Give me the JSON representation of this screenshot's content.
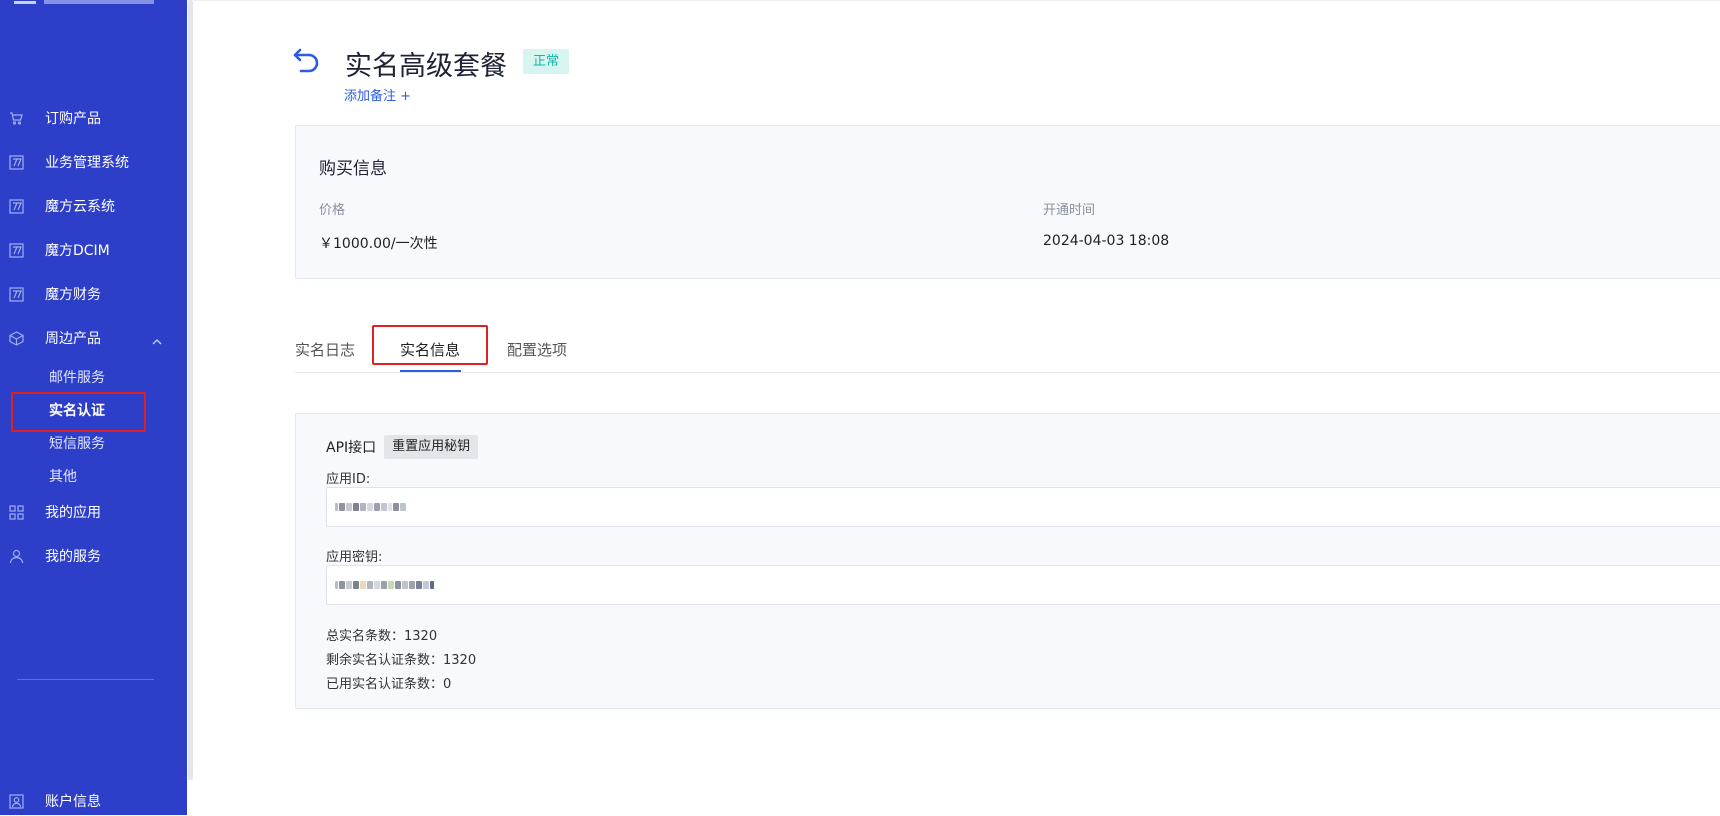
{
  "sidebar": {
    "items": [
      {
        "label": "订购产品",
        "icon": "cart-icon"
      },
      {
        "label": "业务管理系统",
        "icon": "app-icon"
      },
      {
        "label": "魔方云系统",
        "icon": "app-icon"
      },
      {
        "label": "魔方DCIM",
        "icon": "app-icon"
      },
      {
        "label": "魔方财务",
        "icon": "app-icon"
      },
      {
        "label": "周边产品",
        "icon": "box-icon"
      }
    ],
    "sub_items": [
      "邮件服务",
      "实名认证",
      "短信服务",
      "其他"
    ],
    "bottom_items": [
      {
        "label": "我的应用",
        "icon": "grid-icon"
      },
      {
        "label": "我的服务",
        "icon": "user-icon"
      }
    ],
    "account": {
      "label": "账户信息",
      "icon": "account-icon"
    }
  },
  "header": {
    "title": "实名高级套餐",
    "status": "正常",
    "add_note": "添加备注 +"
  },
  "purchase": {
    "title": "购买信息",
    "price_label": "价格",
    "price_value": "￥1000.00/一次性",
    "time_label": "开通时间",
    "time_value": "2024-04-03 18:08"
  },
  "tabs": [
    "实名日志",
    "实名信息",
    "配置选项"
  ],
  "api": {
    "label": "API接口",
    "reset_button": "重置应用秘钥",
    "app_id_label": "应用ID:",
    "app_secret_label": "应用密钥:",
    "total_label": "总实名条数：",
    "total_value": "1320",
    "remaining_label": "剩余实名认证条数：",
    "remaining_value": "1320",
    "used_label": "已用实名认证条数：",
    "used_value": "0"
  },
  "colors": {
    "sidebar_bg": "#2d3ec9",
    "accent": "#2d5be3",
    "status_green": "#17b3a3",
    "highlight_red": "#e02020"
  }
}
